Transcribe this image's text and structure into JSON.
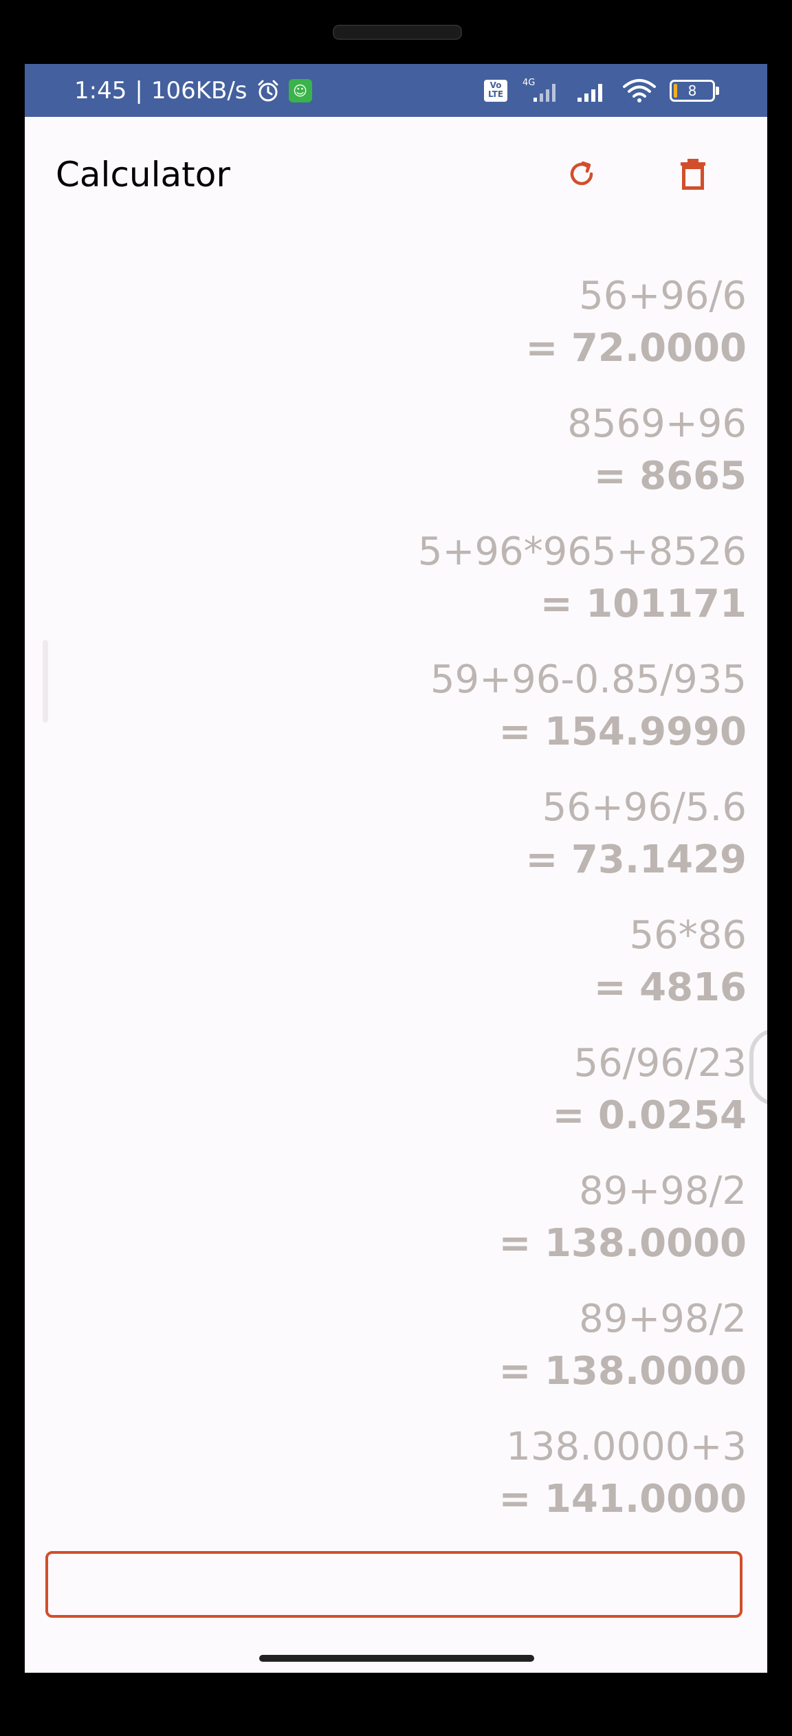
{
  "status": {
    "time": "1:45",
    "network_speed": "106KB/s",
    "battery_level": "8",
    "volte_label": "Vo\nLTE",
    "network_type": "4G"
  },
  "app": {
    "title": "Calculator",
    "icons": {
      "refresh": "refresh-icon",
      "delete": "trash-icon"
    },
    "accent_color": "#d24e2b"
  },
  "history": [
    {
      "expression": "56+96/6",
      "result": "= 72.0000"
    },
    {
      "expression": "8569+96",
      "result": "= 8665"
    },
    {
      "expression": "5+96*965+8526",
      "result": "= 101171"
    },
    {
      "expression": "59+96-0.85/935",
      "result": "= 154.9990"
    },
    {
      "expression": "56+96/5.6",
      "result": "= 73.1429"
    },
    {
      "expression": "56*86",
      "result": "= 4816"
    },
    {
      "expression": "56/96/23",
      "result": "= 0.0254"
    },
    {
      "expression": "89+98/2",
      "result": "= 138.0000"
    },
    {
      "expression": "89+98/2",
      "result": "= 138.0000"
    },
    {
      "expression": "138.0000+3",
      "result": "= 141.0000"
    }
  ],
  "input": {
    "value": "",
    "placeholder": ""
  }
}
